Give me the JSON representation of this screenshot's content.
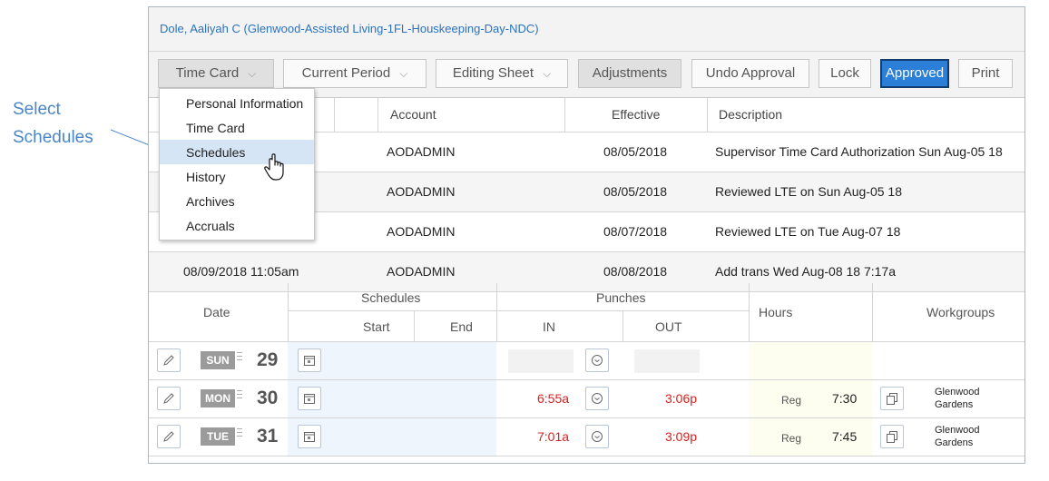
{
  "callout": {
    "line1": "Select",
    "line2": "Schedules"
  },
  "header": {
    "title": "Dole, Aaliyah C (Glenwood-Assisted Living-1FL-Houskeeping-Day-NDC)"
  },
  "toolbar": {
    "timecard": "Time Card",
    "period": "Current Period",
    "editing": "Editing Sheet",
    "adjustments": "Adjustments",
    "undo_approval": "Undo Approval",
    "lock": "Lock",
    "approved": "Approved",
    "print": "Print"
  },
  "menu": {
    "items": [
      "Personal Information",
      "Time Card",
      "Schedules",
      "History",
      "Archives",
      "Accruals"
    ],
    "selected": "Schedules"
  },
  "transactions": {
    "headers": {
      "account": "Account",
      "effective": "Effective",
      "description": "Description"
    },
    "rows": [
      {
        "timestamp": "",
        "account": "AODADMIN",
        "effective": "08/05/2018",
        "description": "Supervisor Time Card Authorization Sun Aug-05 18"
      },
      {
        "timestamp": "",
        "account": "AODADMIN",
        "effective": "08/05/2018",
        "description": "Reviewed LTE on Sun Aug-05 18"
      },
      {
        "timestamp": "",
        "account": "AODADMIN",
        "effective": "08/07/2018",
        "description": "Reviewed LTE on Tue Aug-07 18"
      },
      {
        "timestamp": "08/09/2018 11:05am",
        "account": "AODADMIN",
        "effective": "08/08/2018",
        "description": "Add trans Wed Aug-08 18 7:17a"
      }
    ]
  },
  "grid": {
    "headers": {
      "date": "Date",
      "schedules": "Schedules",
      "start": "Start",
      "end": "End",
      "punches": "Punches",
      "in": "IN",
      "out": "OUT",
      "hours": "Hours",
      "workgroups": "Workgroups"
    },
    "rows": [
      {
        "day": "SUN",
        "num": "29",
        "in": "",
        "out": "",
        "reg": "",
        "hours": "",
        "workgroup": ""
      },
      {
        "day": "MON",
        "num": "30",
        "in": "6:55a",
        "out": "3:06p",
        "reg": "Reg",
        "hours": "7:30",
        "workgroup": "Glenwood Gardens"
      },
      {
        "day": "TUE",
        "num": "31",
        "in": "7:01a",
        "out": "3:09p",
        "reg": "Reg",
        "hours": "7:45",
        "workgroup": "Glenwood Gardens"
      }
    ]
  },
  "icons": [
    "pencil-icon",
    "calendar-icon",
    "clock-icon",
    "copy-icon",
    "hand-cursor-icon",
    "chevron-down-icon"
  ],
  "colors": {
    "accent": "#2c7fd8",
    "title_link": "#2a73c2",
    "punch_red": "#d92020",
    "callout": "#4a86c6"
  }
}
